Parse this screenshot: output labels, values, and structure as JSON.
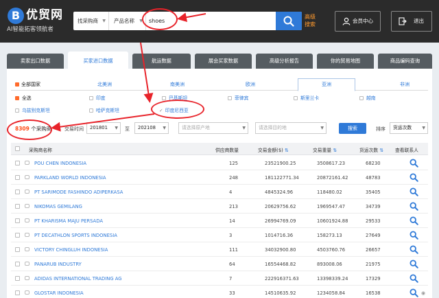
{
  "header": {
    "logo_mark": "B",
    "logo_name": "优贸网",
    "logo_tagline": "AI智能拓客领航者",
    "search": {
      "type_select": "找采购商",
      "field_select": "产品名称",
      "query": "shoes"
    },
    "advanced_label": "高级搜索",
    "member_label": "会员中心",
    "logout_label": "退出"
  },
  "tabs": [
    {
      "label": "卖家出口数据"
    },
    {
      "label": "买家进口数据"
    },
    {
      "label": "航运数据"
    },
    {
      "label": "展会买家数据"
    },
    {
      "label": "高级分析报告"
    },
    {
      "label": "你的贸易地图"
    },
    {
      "label": "商品编码查询"
    }
  ],
  "regions": {
    "all_label": "全部国家",
    "items": [
      "北美洲",
      "南美洲",
      "欧洲",
      "亚洲",
      "非洲"
    ]
  },
  "countries": {
    "all": "全选",
    "items": [
      "印度",
      "巴基斯坦",
      "菲律宾",
      "斯里兰卡",
      "越南",
      "乌兹别克斯坦",
      "哈萨克斯坦",
      "印度尼西亚"
    ],
    "selected": "印度尼西亚"
  },
  "filters": {
    "count_value": "8309",
    "count_suffix": "个采购商",
    "time_label": "交易时间",
    "from": "201801",
    "to_label": "至",
    "to": "202108",
    "origin_placeholder": "请选择原产地",
    "port_placeholder": "请选择目的地",
    "search_button": "搜索",
    "sort_label": "排序",
    "sort_value": "货运次数"
  },
  "table": {
    "headers": {
      "name": "采购商名称",
      "suppliers": "供应商数量",
      "amount": "交易金额($)",
      "weight": "交易重量",
      "shipments": "货运次数",
      "contact": "查看联系人",
      "sort_mark": "⇅"
    },
    "rows": [
      {
        "name": "POU CHEN INDONESIA",
        "suppliers": "125",
        "amount": "23521900.25",
        "weight": "3508617.23",
        "shipments": "68230"
      },
      {
        "name": "PARKLAND WORLD INDONESIA",
        "suppliers": "248",
        "amount": "181122771.34",
        "weight": "20872161.42",
        "shipments": "48783"
      },
      {
        "name": "PT SARIMODE FASHINDO ADIPERKASA",
        "suppliers": "4",
        "amount": "4845324.96",
        "weight": "118480.02",
        "shipments": "35405"
      },
      {
        "name": "NIKOMAS GEMILANG",
        "suppliers": "213",
        "amount": "20629756.62",
        "weight": "1969547.47",
        "shipments": "34739"
      },
      {
        "name": "PT KHARISMA MAJU PERSADA",
        "suppliers": "14",
        "amount": "26994769.09",
        "weight": "10601924.88",
        "shipments": "29533"
      },
      {
        "name": "PT DECATHLON SPORTS INDONESIA",
        "suppliers": "3",
        "amount": "1014716.36",
        "weight": "158273.13",
        "shipments": "27649"
      },
      {
        "name": "VICTORY CHINGLUH INDONESIA",
        "suppliers": "111",
        "amount": "34032900.80",
        "weight": "4503760.76",
        "shipments": "26657"
      },
      {
        "name": "PANARUB INDUSTRY",
        "suppliers": "64",
        "amount": "16554468.82",
        "weight": "893008.06",
        "shipments": "21975"
      },
      {
        "name": "ADIDAS INTERNATIONAL TRADING AG",
        "suppliers": "7",
        "amount": "222916371.63",
        "weight": "13398339.24",
        "shipments": "17329"
      },
      {
        "name": "GLOSTAR INDONESIA",
        "suppliers": "33",
        "amount": "14510635.92",
        "weight": "1234058.84",
        "shipments": "16538"
      }
    ]
  },
  "colors": {
    "accent": "#2f7ad8",
    "header_bg": "#2b2b2b",
    "highlight": "#ff4a16",
    "annotation": "#e8232a"
  }
}
